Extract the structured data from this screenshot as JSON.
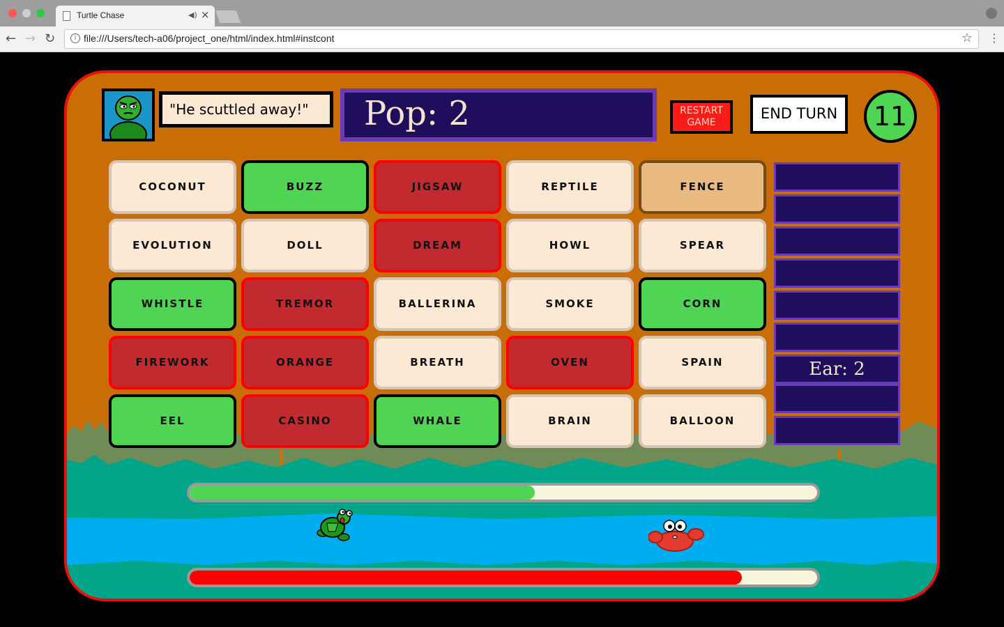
{
  "browser": {
    "tab_title": "Turtle Chase",
    "tab_close": "×",
    "url": "file:///Users/tech-a06/project_one/html/index.html#instcont"
  },
  "game": {
    "speech": "\"He scuttled away!\"",
    "pop_text": "Pop: 2",
    "restart_label": "RESTART GAME",
    "end_turn_label": "END TURN",
    "timer": "11",
    "cards": [
      {
        "word": "COCONUT",
        "state": "neutral"
      },
      {
        "word": "BUZZ",
        "state": "green"
      },
      {
        "word": "JIGSAW",
        "state": "red"
      },
      {
        "word": "REPTILE",
        "state": "neutral"
      },
      {
        "word": "FENCE",
        "state": "tan"
      },
      {
        "word": "EVOLUTION",
        "state": "neutral"
      },
      {
        "word": "DOLL",
        "state": "neutral"
      },
      {
        "word": "DREAM",
        "state": "red"
      },
      {
        "word": "HOWL",
        "state": "neutral"
      },
      {
        "word": "SPEAR",
        "state": "neutral"
      },
      {
        "word": "WHISTLE",
        "state": "green"
      },
      {
        "word": "TREMOR",
        "state": "red"
      },
      {
        "word": "BALLERINA",
        "state": "neutral"
      },
      {
        "word": "SMOKE",
        "state": "neutral"
      },
      {
        "word": "CORN",
        "state": "green"
      },
      {
        "word": "FIREWORK",
        "state": "red"
      },
      {
        "word": "ORANGE",
        "state": "red"
      },
      {
        "word": "BREATH",
        "state": "neutral"
      },
      {
        "word": "OVEN",
        "state": "red"
      },
      {
        "word": "SPAIN",
        "state": "neutral"
      },
      {
        "word": "EEL",
        "state": "green"
      },
      {
        "word": "CASINO",
        "state": "red"
      },
      {
        "word": "WHALE",
        "state": "green"
      },
      {
        "word": "BRAIN",
        "state": "neutral"
      },
      {
        "word": "BALLOON",
        "state": "neutral"
      }
    ],
    "clues": [
      "",
      "",
      "",
      "",
      "",
      "",
      "Ear: 2",
      "",
      ""
    ],
    "turtle_progress": 0.55,
    "crab_progress": 0.88
  },
  "colors": {
    "frame_border": "#e8100c",
    "frame_bg": "#c96d06",
    "pop_bg": "#1e0e5b",
    "pop_border": "#6b3bb5",
    "card_neutral": "#fbe9d4",
    "card_green": "#4fd553",
    "card_red": "#c22a2f",
    "card_tan": "#e9ba82",
    "water": "#00aeef"
  }
}
